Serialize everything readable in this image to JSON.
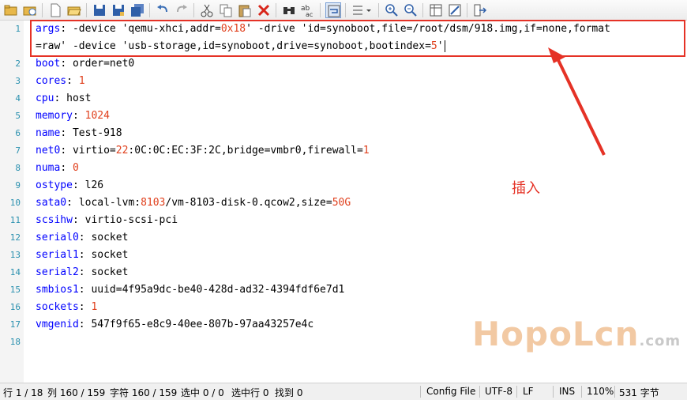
{
  "editor": {
    "lines": [
      {
        "n": "1",
        "parts": [
          [
            "k",
            "args"
          ],
          [
            "s",
            ": -device 'qemu-xhci,addr="
          ],
          [
            "o",
            "0x18"
          ],
          [
            "s",
            "' -drive 'id=synoboot,file=/root/dsm/918.img,if=none,format"
          ]
        ]
      },
      {
        "n": "",
        "parts": [
          [
            "s",
            "=raw' -device 'usb-storage,id=synoboot,drive=synoboot,bootindex="
          ],
          [
            "o",
            "5"
          ],
          [
            "s",
            "'"
          ]
        ]
      },
      {
        "n": "2",
        "parts": [
          [
            "k",
            "boot"
          ],
          [
            "s",
            ": order=net0"
          ]
        ]
      },
      {
        "n": "3",
        "parts": [
          [
            "k",
            "cores"
          ],
          [
            "s",
            ": "
          ],
          [
            "o",
            "1"
          ]
        ]
      },
      {
        "n": "4",
        "parts": [
          [
            "k",
            "cpu"
          ],
          [
            "s",
            ": host"
          ]
        ]
      },
      {
        "n": "5",
        "parts": [
          [
            "k",
            "memory"
          ],
          [
            "s",
            ": "
          ],
          [
            "o",
            "1024"
          ]
        ]
      },
      {
        "n": "6",
        "parts": [
          [
            "k",
            "name"
          ],
          [
            "s",
            ": Test-918"
          ]
        ]
      },
      {
        "n": "7",
        "parts": [
          [
            "k",
            "net0"
          ],
          [
            "s",
            ": virtio="
          ],
          [
            "o",
            "22"
          ],
          [
            "s",
            ":0C:0C:EC:3F:2C,bridge=vmbr0,firewall="
          ],
          [
            "o",
            "1"
          ]
        ]
      },
      {
        "n": "8",
        "parts": [
          [
            "k",
            "numa"
          ],
          [
            "s",
            ": "
          ],
          [
            "o",
            "0"
          ]
        ]
      },
      {
        "n": "9",
        "parts": [
          [
            "k",
            "ostype"
          ],
          [
            "s",
            ": l26"
          ]
        ]
      },
      {
        "n": "10",
        "parts": [
          [
            "k",
            "sata0"
          ],
          [
            "s",
            ": local-lvm:"
          ],
          [
            "o",
            "8103"
          ],
          [
            "s",
            "/vm-8103-disk-0.qcow2,size="
          ],
          [
            "o",
            "50G"
          ]
        ]
      },
      {
        "n": "11",
        "parts": [
          [
            "k",
            "scsihw"
          ],
          [
            "s",
            ": virtio-scsi-pci"
          ]
        ]
      },
      {
        "n": "12",
        "parts": [
          [
            "k",
            "serial0"
          ],
          [
            "s",
            ": socket"
          ]
        ]
      },
      {
        "n": "13",
        "parts": [
          [
            "k",
            "serial1"
          ],
          [
            "s",
            ": socket"
          ]
        ]
      },
      {
        "n": "14",
        "parts": [
          [
            "k",
            "serial2"
          ],
          [
            "s",
            ": socket"
          ]
        ]
      },
      {
        "n": "15",
        "parts": [
          [
            "k",
            "smbios1"
          ],
          [
            "s",
            ": uuid=4f95a9dc-be40-428d-ad32-4394fdf6e7d1"
          ]
        ]
      },
      {
        "n": "16",
        "parts": [
          [
            "k",
            "sockets"
          ],
          [
            "s",
            ": "
          ],
          [
            "o",
            "1"
          ]
        ]
      },
      {
        "n": "17",
        "parts": [
          [
            "k",
            "vmgenid"
          ],
          [
            "s",
            ": 547f9f65-e8c9-40ee-807b-97aa43257e4c"
          ]
        ]
      },
      {
        "n": "18",
        "parts": []
      }
    ]
  },
  "annotation": {
    "note": "插入",
    "color": "#e53226"
  },
  "watermark": {
    "main": "HopoLcn",
    "suffix": ".com"
  },
  "status": {
    "row": "行 1 / 18",
    "col": "列 160 / 159",
    "chars": "字符 160 / 159",
    "selected": "选中 0 / 0",
    "selected_lines": "选中行 0",
    "found": "找到 0",
    "file_type": "Config File",
    "encoding": "UTF-8",
    "line_ending": "LF",
    "insert_mode": "INS",
    "zoom": "110%",
    "bytes": "531 字节"
  },
  "toolbar": {
    "icons": [
      "open-folder-icon",
      "open-recent-icon",
      "new-file-icon",
      "open-file-icon",
      "save-icon",
      "save-as-icon",
      "save-all-icon",
      "undo-icon",
      "redo-icon",
      "cut-icon",
      "copy-icon",
      "paste-icon",
      "delete-icon",
      "find-icon",
      "replace-icon",
      "word-wrap-icon",
      "list-icon",
      "zoom-in-icon",
      "zoom-out-icon",
      "column-icon",
      "edit-tool-icon",
      "exit-icon"
    ]
  }
}
